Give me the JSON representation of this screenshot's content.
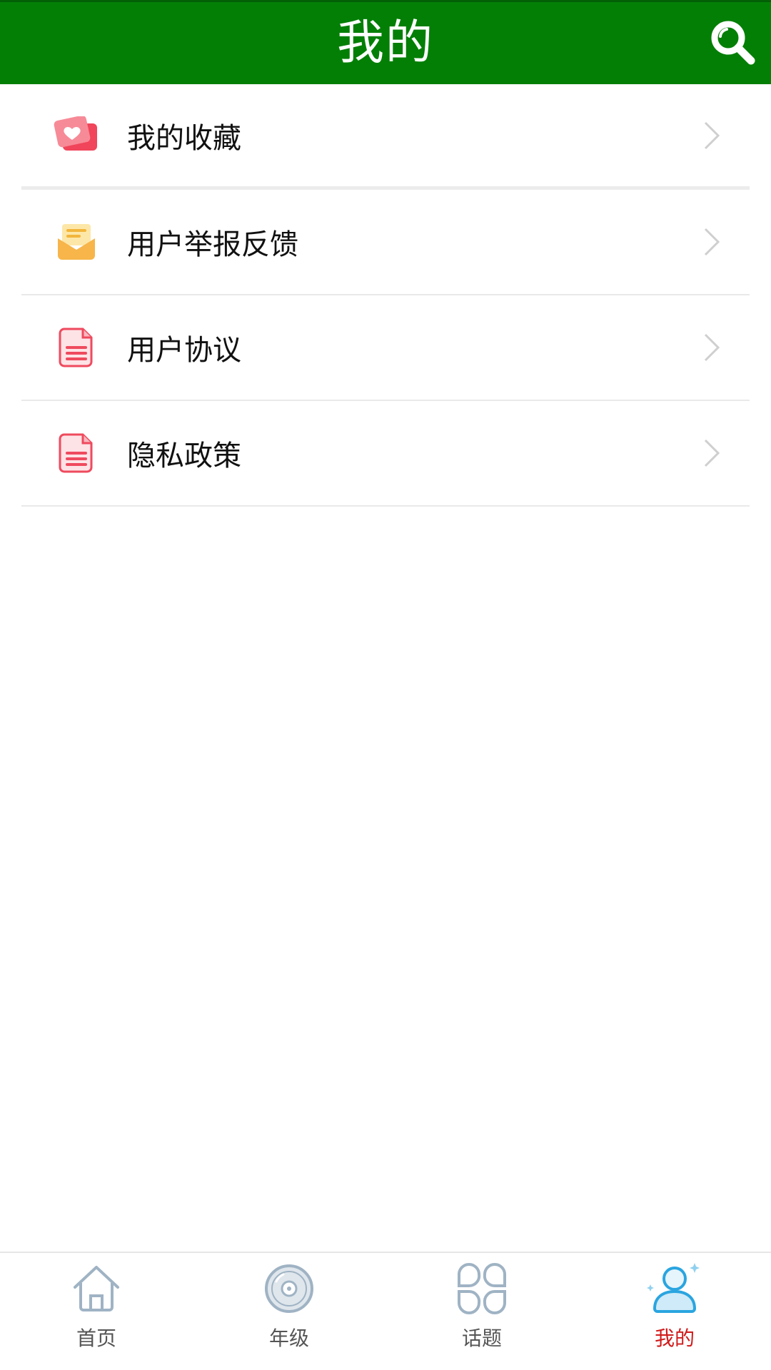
{
  "header": {
    "title": "我的",
    "search_icon": "search-icon"
  },
  "menu": {
    "items": [
      {
        "label": "我的收藏",
        "icon": "favorites-icon"
      },
      {
        "label": "用户举报反馈",
        "icon": "mail-icon"
      },
      {
        "label": "用户协议",
        "icon": "document-icon"
      },
      {
        "label": "隐私政策",
        "icon": "document-icon"
      }
    ]
  },
  "tabbar": {
    "tabs": [
      {
        "label": "首页",
        "icon": "home-icon"
      },
      {
        "label": "年级",
        "icon": "disc-icon"
      },
      {
        "label": "话题",
        "icon": "grid-icon"
      },
      {
        "label": "我的",
        "icon": "user-icon",
        "active": true
      }
    ]
  },
  "colors": {
    "header_bg": "#037f06",
    "active_tab": "#d11a1a",
    "inactive_tab": "#9fb3c4"
  }
}
